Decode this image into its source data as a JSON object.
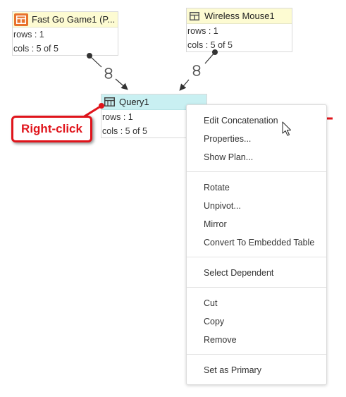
{
  "nodes": {
    "fast_go": {
      "title": "Fast Go Game1 (P...",
      "rows": "rows : 1",
      "cols": "cols : 5 of 5"
    },
    "wireless": {
      "title": "Wireless Mouse1",
      "rows": "rows : 1",
      "cols": "cols : 5 of 5"
    },
    "query": {
      "title": "Query1",
      "rows": "rows : 1",
      "cols": "cols : 5 of 5"
    }
  },
  "callout": {
    "label": "Right-click"
  },
  "context_menu": {
    "items": [
      "Edit Concatenation",
      "Properties...",
      "Show Plan...",
      "Rotate",
      "Unpivot...",
      "Mirror",
      "Convert To Embedded Table",
      "Select Dependent",
      "Cut",
      "Copy",
      "Remove",
      "Set as Primary"
    ]
  },
  "colors": {
    "table_header_bg": "#fdfbd2",
    "query_header_bg": "#c9f0f2",
    "accent_orange": "#e8722c",
    "annotation_red": "#e0141b"
  },
  "icons": {
    "fast_go": "table-orange-icon",
    "wireless": "table-grid-icon",
    "query": "query-grid-icon",
    "link": "link-icon",
    "cursor": "mouse-pointer-icon"
  }
}
